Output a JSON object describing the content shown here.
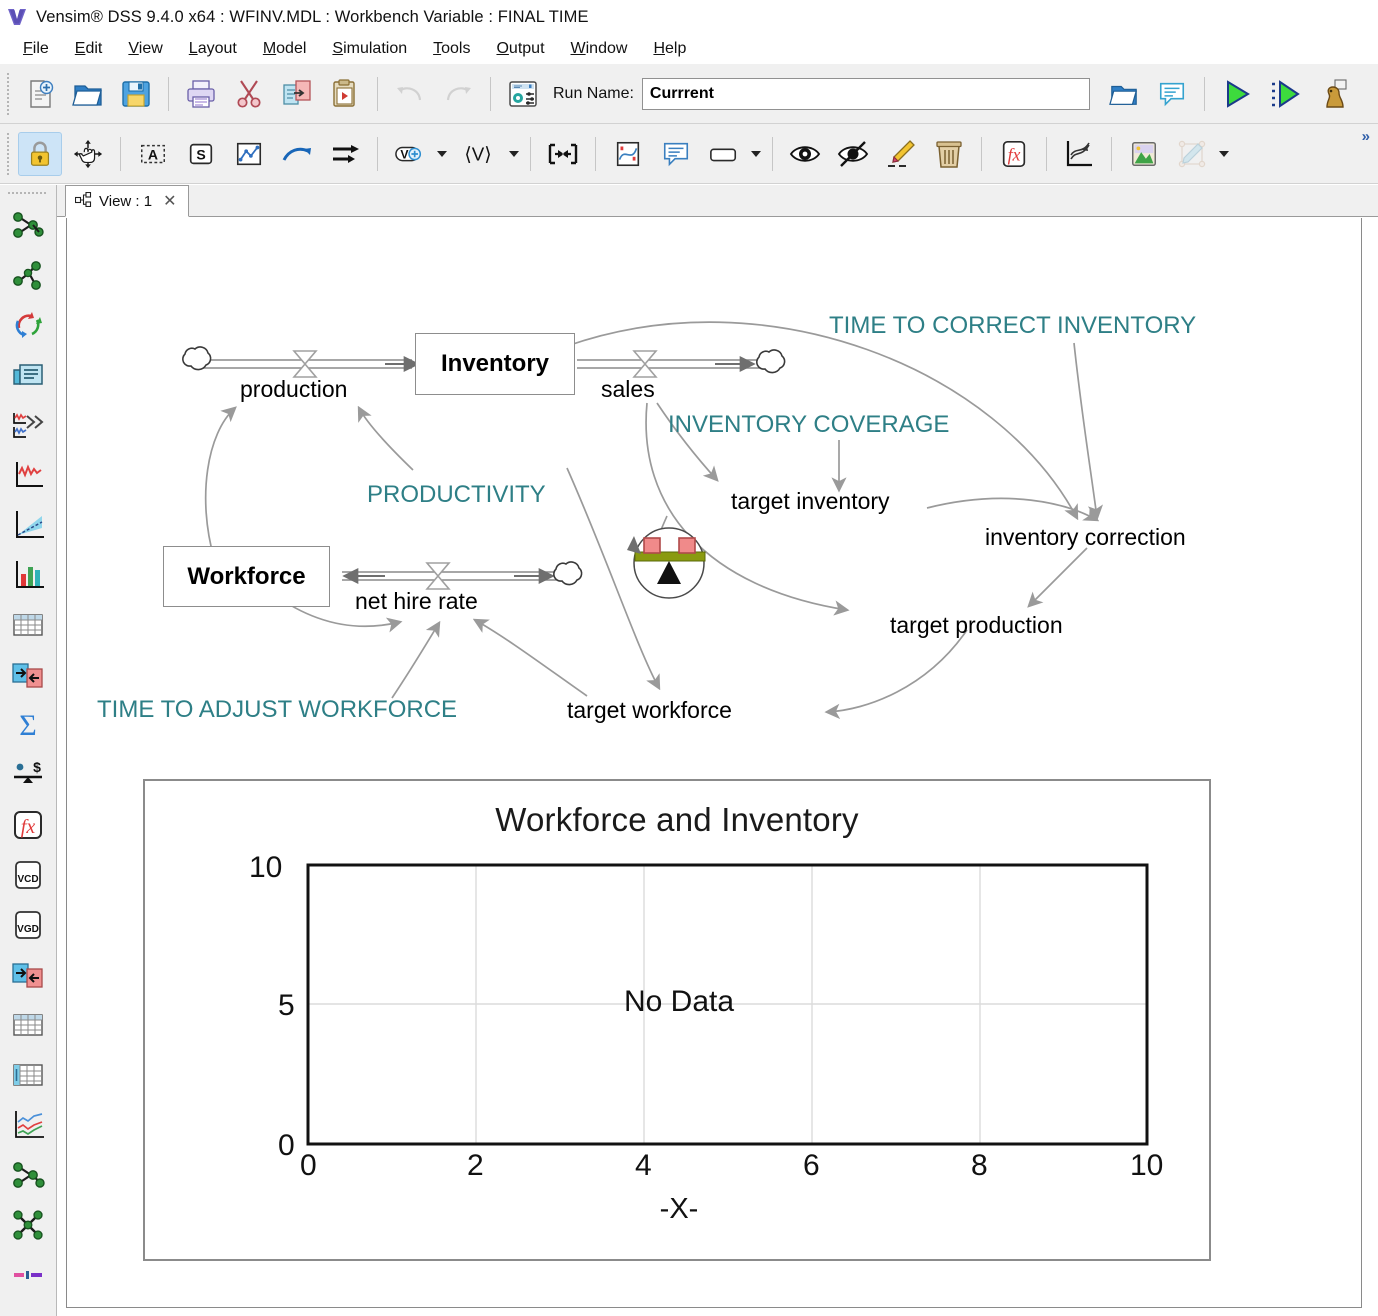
{
  "window": {
    "title": "Vensim® DSS 9.4.0 x64 : WFINV.MDL : Workbench Variable : FINAL TIME",
    "logo_letter": "V"
  },
  "menu": {
    "items": [
      {
        "label": "File",
        "accel": "F"
      },
      {
        "label": "Edit",
        "accel": "E"
      },
      {
        "label": "View",
        "accel": "V"
      },
      {
        "label": "Layout",
        "accel": "L"
      },
      {
        "label": "Model",
        "accel": "M"
      },
      {
        "label": "Simulation",
        "accel": "S"
      },
      {
        "label": "Tools",
        "accel": "T"
      },
      {
        "label": "Output",
        "accel": "O"
      },
      {
        "label": "Window",
        "accel": "W"
      },
      {
        "label": "Help",
        "accel": "H"
      }
    ]
  },
  "toolbar_main": {
    "run_name_label": "Run Name:",
    "run_name_value": "Currrent",
    "buttons": [
      {
        "name": "new-model-icon",
        "tip": "New Model"
      },
      {
        "name": "open-model-icon",
        "tip": "Open Model"
      },
      {
        "name": "save-model-icon",
        "tip": "Save"
      },
      {
        "name": "print-icon",
        "tip": "Print"
      },
      {
        "name": "cut-icon",
        "tip": "Cut"
      },
      {
        "name": "copy-icon",
        "tip": "Copy"
      },
      {
        "name": "paste-icon",
        "tip": "Paste"
      },
      {
        "name": "undo-icon",
        "tip": "Undo"
      },
      {
        "name": "redo-icon",
        "tip": "Redo"
      },
      {
        "name": "simulation-setup-icon",
        "tip": "Simulation Control"
      },
      {
        "name": "open-run-icon",
        "tip": "Open Run"
      },
      {
        "name": "run-comment-icon",
        "tip": "Run Comment"
      },
      {
        "name": "run-simulation-icon",
        "tip": "Run a Simulation"
      },
      {
        "name": "run-synthesim-icon",
        "tip": "SyntheSim"
      },
      {
        "name": "game-mode-icon",
        "tip": "Game"
      }
    ]
  },
  "toolbar_sketch": {
    "buttons": [
      {
        "name": "lock-icon",
        "tip": "Lock",
        "active": true
      },
      {
        "name": "move-size-icon",
        "tip": "Move/Size"
      },
      {
        "name": "variable-tool-icon",
        "tip": "Variable",
        "glyph": "A"
      },
      {
        "name": "stock-tool-icon",
        "tip": "Box Variable",
        "glyph": "S"
      },
      {
        "name": "rate-tool-icon",
        "tip": "Rate"
      },
      {
        "name": "arrow-tool-icon",
        "tip": "Arrow"
      },
      {
        "name": "shadow-tool-icon",
        "tip": "Flow Tool"
      },
      {
        "name": "add-variable-icon",
        "tip": "Input Output Object"
      },
      {
        "name": "shadow-variable-icon",
        "tip": "Shadow Variable"
      },
      {
        "name": "merge-icon",
        "tip": "Merge"
      },
      {
        "name": "sketch-graph-icon",
        "tip": "Sketch Graph"
      },
      {
        "name": "comment-icon",
        "tip": "Comment"
      },
      {
        "name": "rectangle-icon",
        "tip": "Shape"
      },
      {
        "name": "show-icon",
        "tip": "Show"
      },
      {
        "name": "hide-icon",
        "tip": "Hide"
      },
      {
        "name": "paint-icon",
        "tip": "Paint"
      },
      {
        "name": "delete-icon",
        "tip": "Delete"
      },
      {
        "name": "equations-icon",
        "tip": "Equations"
      },
      {
        "name": "reference-mode-icon",
        "tip": "Reference Modes"
      },
      {
        "name": "image-icon",
        "tip": "Picture"
      },
      {
        "name": "sketch-edit-icon",
        "tip": "Sketch Editing"
      }
    ],
    "overflow_label": "»"
  },
  "sidebar": {
    "items": [
      {
        "name": "causes-tree-icon",
        "tip": "Causes Tree"
      },
      {
        "name": "uses-tree-icon",
        "tip": "Uses Tree"
      },
      {
        "name": "loops-icon",
        "tip": "Loops"
      },
      {
        "name": "document-icon",
        "tip": "Document"
      },
      {
        "name": "causes-strip-icon",
        "tip": "Causes Strip Graph"
      },
      {
        "name": "graph-icon",
        "tip": "Graph"
      },
      {
        "name": "sensitivity-graph-icon",
        "tip": "Sensitivity Graph"
      },
      {
        "name": "bar-graph-icon",
        "tip": "Bar Graph"
      },
      {
        "name": "table-icon",
        "tip": "Table"
      },
      {
        "name": "table-time-down-icon",
        "tip": "Table Time Down"
      },
      {
        "name": "runs-compare-icon",
        "tip": "Runs Compare"
      },
      {
        "name": "sum-icon",
        "tip": "Stats"
      },
      {
        "name": "units-check-icon",
        "tip": "Units Check"
      },
      {
        "name": "function-icon",
        "tip": "Function"
      },
      {
        "name": "vcd-icon",
        "tip": "VCD",
        "glyph": "VCD"
      },
      {
        "name": "vgd-icon",
        "tip": "VGD",
        "glyph": "VGD"
      },
      {
        "name": "compare-runs-icon",
        "tip": "Compare Runs"
      },
      {
        "name": "table-grid-icon",
        "tip": "Table"
      },
      {
        "name": "table-bars-icon",
        "tip": "Table with Bars"
      },
      {
        "name": "multi-line-graph-icon",
        "tip": "Multiple Line Graph"
      },
      {
        "name": "causes-tree2-icon",
        "tip": "Causes Tree"
      },
      {
        "name": "loops-tree-icon",
        "tip": "Loops Tree"
      },
      {
        "name": "color-bar-icon",
        "tip": "Colors"
      }
    ]
  },
  "view_tab": {
    "label": "View : 1",
    "close_glyph": "✕",
    "icon": "sketch-view-icon"
  },
  "diagram": {
    "stocks": [
      {
        "name": "Inventory",
        "label": "Inventory"
      },
      {
        "name": "Workforce",
        "label": "Workforce"
      }
    ],
    "flows": [
      {
        "name": "production",
        "label": "production"
      },
      {
        "name": "sales",
        "label": "sales"
      },
      {
        "name": "net hire rate",
        "label": "net hire rate"
      }
    ],
    "auxiliaries": [
      {
        "name": "target inventory",
        "label": "target inventory"
      },
      {
        "name": "inventory correction",
        "label": "inventory correction"
      },
      {
        "name": "target production",
        "label": "target production"
      },
      {
        "name": "target workforce",
        "label": "target workforce"
      }
    ],
    "constants": [
      {
        "name": "TIME TO CORRECT INVENTORY",
        "label": "TIME TO CORRECT INVENTORY"
      },
      {
        "name": "INVENTORY COVERAGE",
        "label": "INVENTORY COVERAGE"
      },
      {
        "name": "PRODUCTIVITY",
        "label": "PRODUCTIVITY"
      },
      {
        "name": "TIME TO ADJUST WORKFORCE",
        "label": "TIME TO ADJUST WORKFORCE"
      }
    ],
    "widgets": [
      {
        "name": "slider-widget",
        "type": "balance-slider"
      }
    ],
    "colors": {
      "constant_text": "#2e7f86",
      "arrow": "#9a9a9a",
      "stock_border": "#8d8d8d",
      "flow_line": "#7f7f7f"
    }
  },
  "chart_data": {
    "type": "line",
    "title": "Workforce and Inventory",
    "xlabel": "-X-",
    "ylabel": "",
    "xlim": [
      0,
      10
    ],
    "ylim": [
      0,
      10
    ],
    "xticks": [
      0,
      2,
      4,
      6,
      8,
      10
    ],
    "yticks": [
      0,
      5,
      10
    ],
    "grid": true,
    "series": [],
    "empty_message": "No Data",
    "legend": []
  }
}
